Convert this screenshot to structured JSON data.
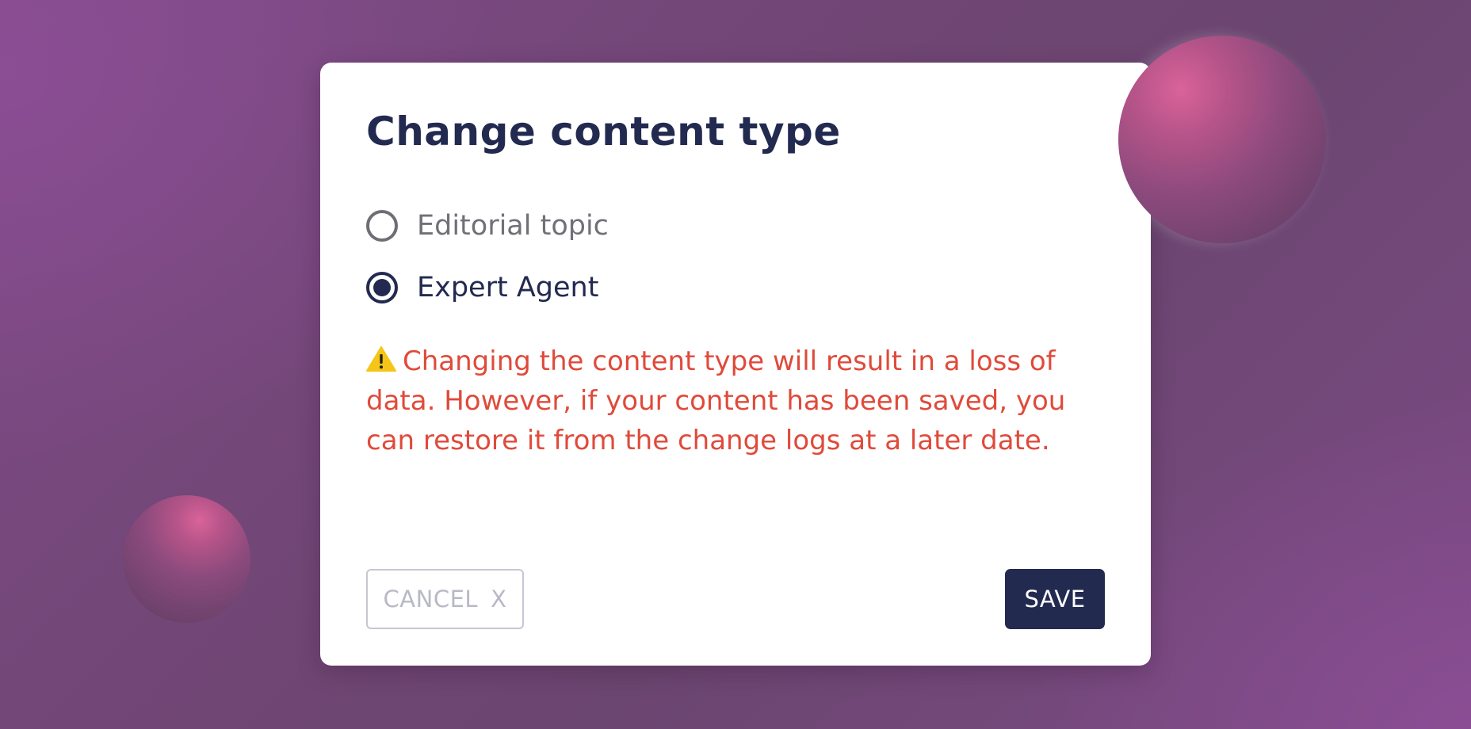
{
  "dialog": {
    "title": "Change content type",
    "options": [
      {
        "label": "Editorial topic",
        "selected": false
      },
      {
        "label": "Expert Agent",
        "selected": true
      }
    ],
    "warning": {
      "icon": "warning-icon",
      "text": "Changing the content type will result in a loss of data. However, if your content has been saved, you can restore it from the change logs at a later date."
    },
    "cancel_label": "CANCEL",
    "cancel_icon_text": "X",
    "save_label": "SAVE"
  },
  "colors": {
    "primary": "#222a50",
    "warning_text": "#e04a3a",
    "warning_icon": "#f5c518",
    "background": "#6f4673",
    "sphere_accent": "#d9639a"
  }
}
